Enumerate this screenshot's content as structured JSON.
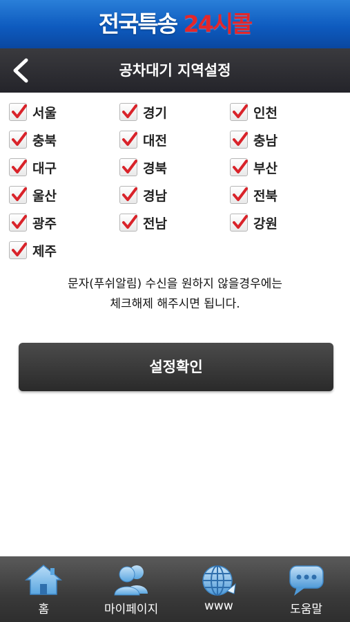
{
  "header": {
    "title_main": "전국특송 ",
    "title_accent": "24시콜",
    "accent_color": "#e3262a",
    "brand_color": "#0e5bbf"
  },
  "title_bar": {
    "back_icon": "chevron-left-icon",
    "title": "공차대기 지역설정"
  },
  "regions": [
    {
      "label": "서울",
      "checked": true
    },
    {
      "label": "경기",
      "checked": true
    },
    {
      "label": "인천",
      "checked": true
    },
    {
      "label": "충북",
      "checked": true
    },
    {
      "label": "대전",
      "checked": true
    },
    {
      "label": "충남",
      "checked": true
    },
    {
      "label": "대구",
      "checked": true
    },
    {
      "label": "경북",
      "checked": true
    },
    {
      "label": "부산",
      "checked": true
    },
    {
      "label": "울산",
      "checked": true
    },
    {
      "label": "경남",
      "checked": true
    },
    {
      "label": "전북",
      "checked": true
    },
    {
      "label": "광주",
      "checked": true
    },
    {
      "label": "전남",
      "checked": true
    },
    {
      "label": "강원",
      "checked": true
    },
    {
      "label": "제주",
      "checked": true
    }
  ],
  "check_color": "#d9232a",
  "notice": {
    "line1": "문자(푸쉬알림) 수신을 원하지 않을경우에는",
    "line2": "체크해제 해주시면 됩니다."
  },
  "confirm_button": {
    "label": "설정확인"
  },
  "bottom_nav": [
    {
      "label": "홈",
      "icon": "home-icon"
    },
    {
      "label": "마이페이지",
      "icon": "users-icon"
    },
    {
      "label": "www",
      "icon": "globe-icon"
    },
    {
      "label": "도움말",
      "icon": "chat-bubble-icon"
    }
  ]
}
